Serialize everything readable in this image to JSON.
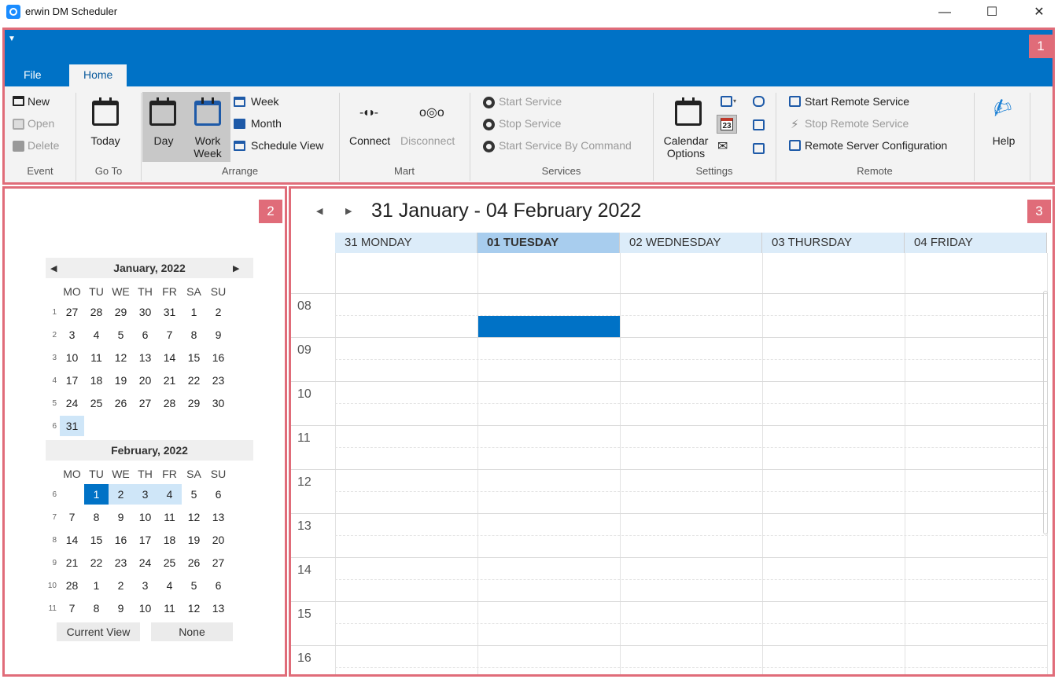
{
  "window": {
    "title": "erwin DM Scheduler",
    "min_glyph": "—",
    "max_glyph": "☐",
    "close_glyph": "✕"
  },
  "badges": [
    "1",
    "2",
    "3"
  ],
  "ribbon": {
    "tabs": [
      "File",
      "Home"
    ],
    "active_tab": "Home",
    "event": {
      "new": "New",
      "open": "Open",
      "delete": "Delete",
      "label": "Event"
    },
    "goto": {
      "today": "Today",
      "label": "Go To"
    },
    "arrange": {
      "day": "Day",
      "work_week_1": "Work",
      "work_week_2": "Week",
      "week": "Week",
      "month": "Month",
      "schedule_view": "Schedule View",
      "label": "Arrange"
    },
    "mart": {
      "connect": "Connect",
      "disconnect": "Disconnect",
      "label": "Mart"
    },
    "services": {
      "start": "Start Service",
      "stop": "Stop Service",
      "start_by_command": "Start Service By Command",
      "label": "Services"
    },
    "settings": {
      "calendar_options_1": "Calendar",
      "calendar_options_2": "Options",
      "date_badge": "23",
      "label": "Settings"
    },
    "remote": {
      "start": "Start Remote Service",
      "stop": "Stop Remote Service",
      "config": "Remote Server Configuration",
      "label": "Remote"
    },
    "help": {
      "label": "Help"
    }
  },
  "mini_calendar": {
    "weekday_headers": [
      "MO",
      "TU",
      "WE",
      "TH",
      "FR",
      "SA",
      "SU"
    ],
    "months": [
      {
        "title": "January, 2022",
        "weeks": [
          {
            "num": "1",
            "days": [
              "27",
              "28",
              "29",
              "30",
              "31",
              "1",
              "2"
            ]
          },
          {
            "num": "2",
            "days": [
              "3",
              "4",
              "5",
              "6",
              "7",
              "8",
              "9"
            ]
          },
          {
            "num": "3",
            "days": [
              "10",
              "11",
              "12",
              "13",
              "14",
              "15",
              "16"
            ]
          },
          {
            "num": "4",
            "days": [
              "17",
              "18",
              "19",
              "20",
              "21",
              "22",
              "23"
            ]
          },
          {
            "num": "5",
            "days": [
              "24",
              "25",
              "26",
              "27",
              "28",
              "29",
              "30"
            ]
          },
          {
            "num": "6",
            "days": [
              "31",
              "",
              "",
              "",
              "",
              "",
              ""
            ]
          }
        ]
      },
      {
        "title": "February, 2022",
        "weeks": [
          {
            "num": "6",
            "days": [
              "",
              "1",
              "2",
              "3",
              "4",
              "5",
              "6"
            ]
          },
          {
            "num": "7",
            "days": [
              "7",
              "8",
              "9",
              "10",
              "11",
              "12",
              "13"
            ]
          },
          {
            "num": "8",
            "days": [
              "14",
              "15",
              "16",
              "17",
              "18",
              "19",
              "20"
            ]
          },
          {
            "num": "9",
            "days": [
              "21",
              "22",
              "23",
              "24",
              "25",
              "26",
              "27"
            ]
          },
          {
            "num": "10",
            "days": [
              "28",
              "1",
              "2",
              "3",
              "4",
              "5",
              "6"
            ]
          },
          {
            "num": "11",
            "days": [
              "7",
              "8",
              "9",
              "10",
              "11",
              "12",
              "13"
            ]
          }
        ]
      }
    ],
    "current_view_button": "Current View",
    "none_button": "None"
  },
  "schedule": {
    "range_title": "31 January - 04 February 2022",
    "days": [
      "31 MONDAY",
      "01 TUESDAY",
      "02 WEDNESDAY",
      "03 THURSDAY",
      "04 FRIDAY"
    ],
    "today_index": 1,
    "hours": [
      "08",
      "09",
      "10",
      "11",
      "12",
      "13",
      "14",
      "15",
      "16"
    ],
    "colors": {
      "accent": "#0072c6",
      "today_header": "#a8cdee",
      "day_header": "#dcecf9",
      "frame": "#e06c79"
    }
  }
}
